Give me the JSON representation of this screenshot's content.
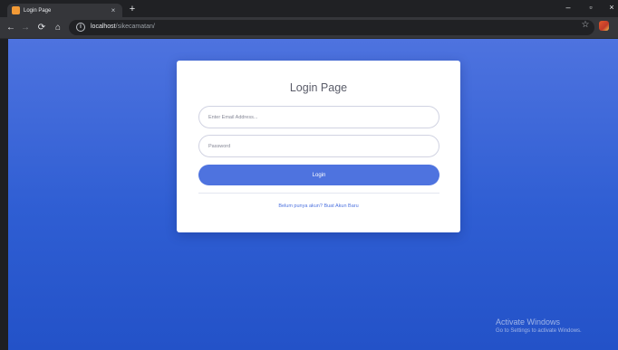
{
  "browser": {
    "tab_title": "Login Page",
    "tab_close": "×",
    "new_tab": "+",
    "url_host": "localhost",
    "url_path": "/sikecamatan/",
    "colors": {
      "favicon": "#f29a36",
      "tabstrip": "#202124",
      "toolbar": "#35363a"
    },
    "icons": {
      "back": "back-arrow-icon",
      "forward": "forward-arrow-icon",
      "reload": "reload-icon",
      "home": "home-icon",
      "info": "info-icon",
      "star": "star-icon",
      "extension": "extension-icon",
      "minimize": "minimize-icon",
      "maximize": "maximize-icon",
      "close": "window-close-icon"
    }
  },
  "login": {
    "title": "Login Page",
    "email_placeholder": "Enter Email Address...",
    "password_placeholder": "Password",
    "login_label": "Login",
    "register_link": "Belum punya akun? Buat Akun Baru"
  },
  "theme": {
    "page_gradient_top": "#4e73df",
    "page_gradient_bottom": "#2352c8",
    "primary": "#4e73df"
  },
  "watermark": {
    "title": "Activate Windows",
    "subtitle": "Go to Settings to activate Windows."
  }
}
